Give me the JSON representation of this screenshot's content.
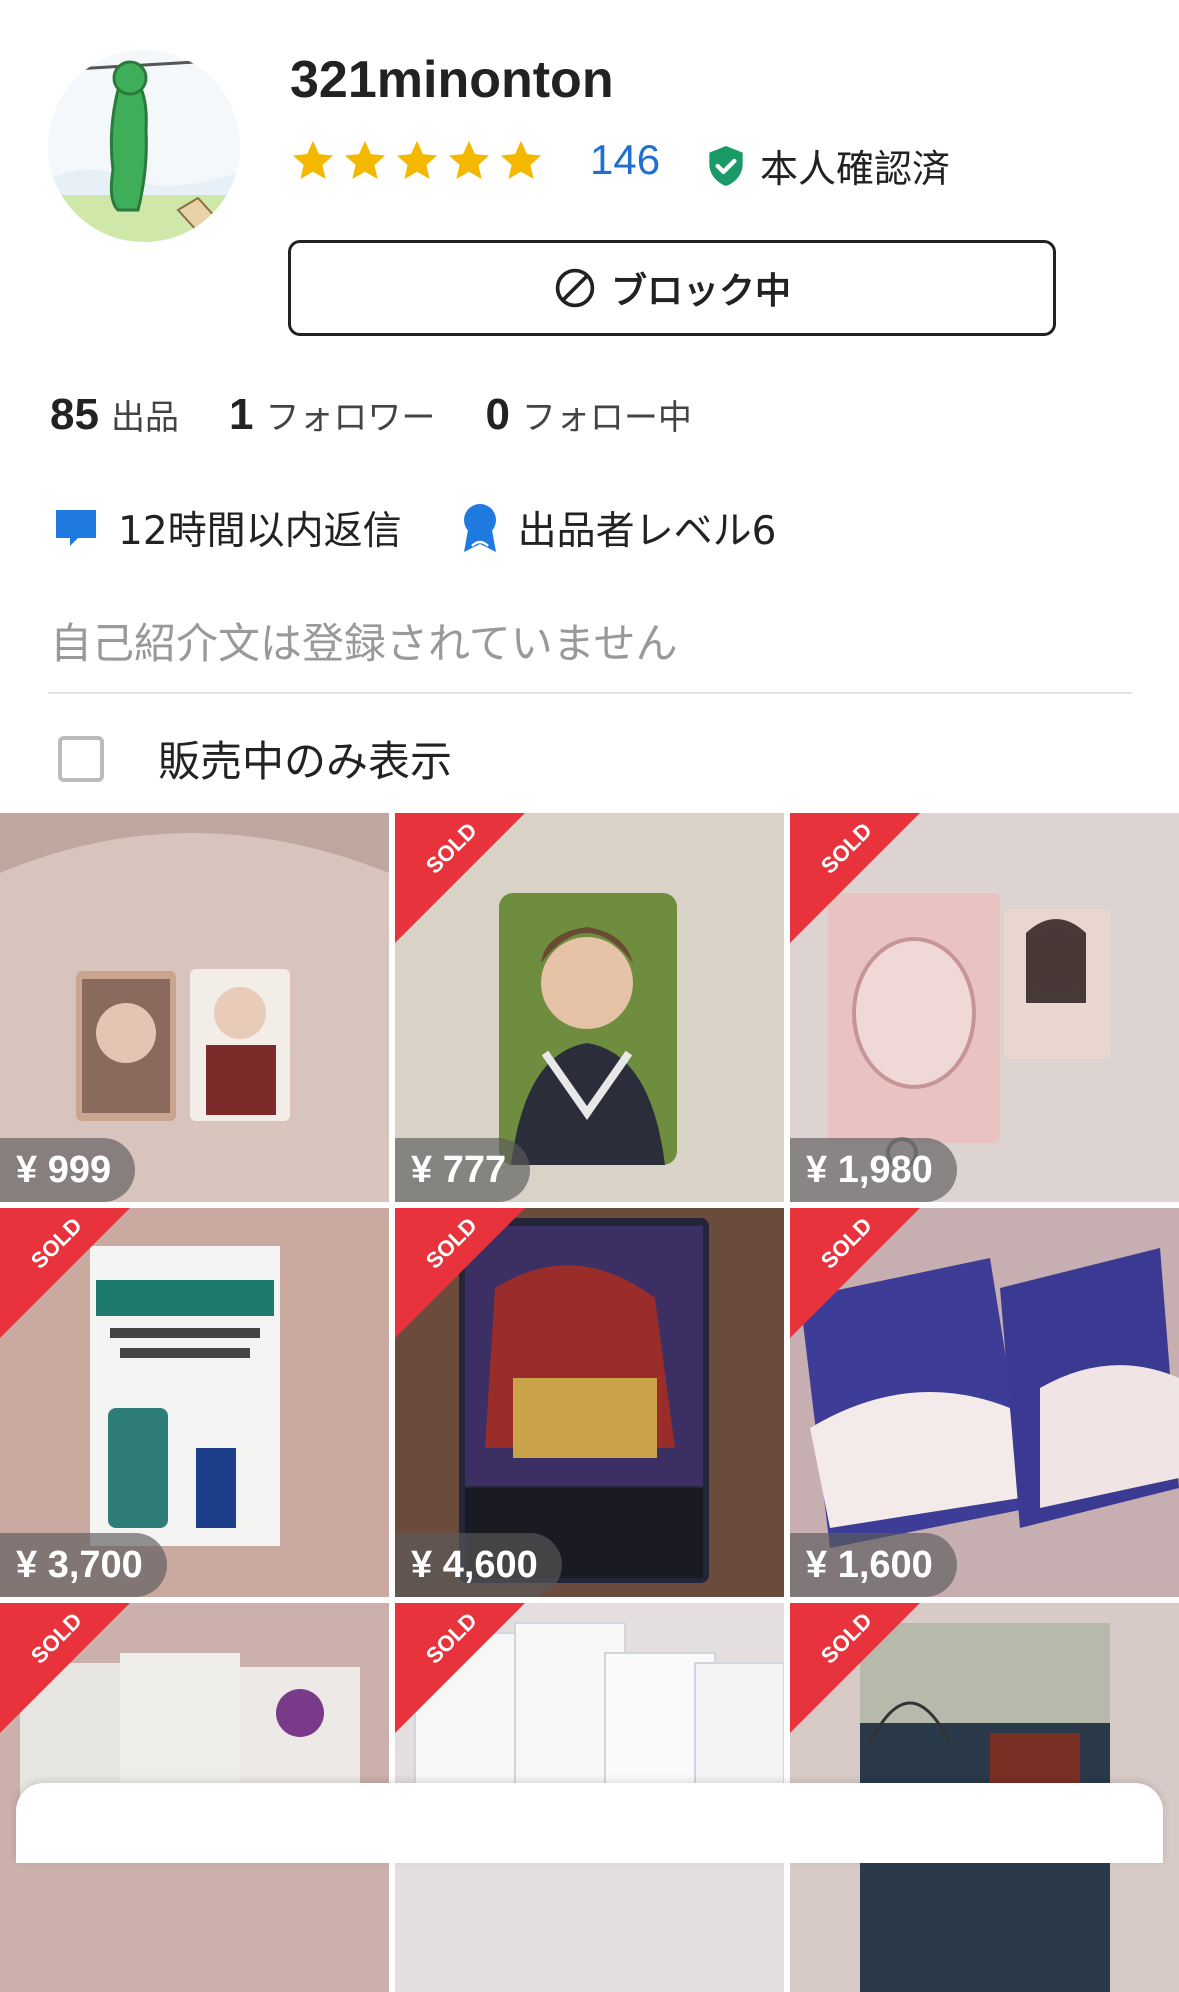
{
  "profile": {
    "username": "321minonton",
    "rating_count": "146",
    "rating_stars": 5,
    "verified_label": "本人確認済",
    "block_label": "ブロック中"
  },
  "stats": [
    {
      "num": "85",
      "label": "出品"
    },
    {
      "num": "1",
      "label": "フォロワー"
    },
    {
      "num": "0",
      "label": "フォロー中"
    }
  ],
  "badges": {
    "response": "12時間以内返信",
    "level": "出品者レベル6"
  },
  "bio_placeholder": "自己紹介文は登録されていません",
  "filter": {
    "label": "販売中のみ表示",
    "checked": false
  },
  "items": [
    {
      "price": "¥ 999",
      "sold": false
    },
    {
      "price": "¥ 777",
      "sold": true,
      "sold_label": "SOLD"
    },
    {
      "price": "¥ 1,980",
      "sold": true,
      "sold_label": "SOLD"
    },
    {
      "price": "¥ 3,700",
      "sold": true,
      "sold_label": "SOLD"
    },
    {
      "price": "¥ 4,600",
      "sold": true,
      "sold_label": "SOLD"
    },
    {
      "price": "¥ 1,600",
      "sold": true,
      "sold_label": "SOLD"
    },
    {
      "price": "",
      "sold": true,
      "sold_label": "SOLD"
    },
    {
      "price": "",
      "sold": true,
      "sold_label": "SOLD"
    },
    {
      "price": "",
      "sold": true,
      "sold_label": "SOLD"
    }
  ],
  "colors": {
    "accent_blue": "#1f6fd1",
    "star": "#f5b800",
    "verified": "#1a9a68",
    "sold_red": "#e8323c"
  }
}
